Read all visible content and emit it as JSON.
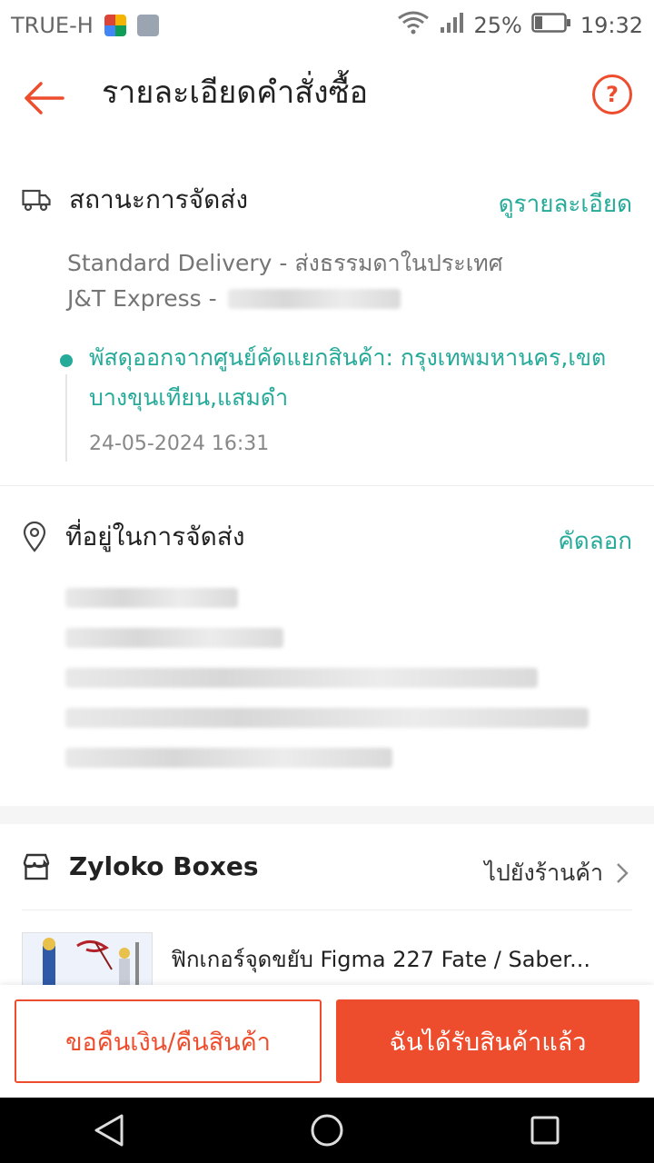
{
  "status_bar": {
    "carrier": "TRUE-H",
    "battery": "25%",
    "time": "19:32",
    "icons": [
      "app-icon",
      "gallery-icon",
      "wifi-icon",
      "signal-icon",
      "battery-icon"
    ]
  },
  "header": {
    "title": "รายละเอียดคำสั่งซื้อ",
    "help_label": "?"
  },
  "delivery": {
    "title": "สถานะการจัดส่ง",
    "link": "ดูรายละเอียด",
    "method": "Standard Delivery - ส่งธรรมดาในประเทศ",
    "courier": "J&T Express -",
    "status_text": "พัสดุออกจากศูนย์คัดแยกสินค้า: กรุงเทพมหานคร,เขตบางขุนเทียน,แสมดำ",
    "status_time": "24-05-2024 16:31"
  },
  "address": {
    "title": "ที่อยู่ในการจัดส่ง",
    "link": "คัดลอก"
  },
  "shop": {
    "name": "Zyloko Boxes",
    "link": "ไปยังร้านค้า",
    "product_title": "ฟิกเกอร์จุดขยับ Figma 227 Fate / Saber..."
  },
  "actions": {
    "refund_label": "ขอคืนเงิน/คืนสินค้า",
    "received_label": "ฉันได้รับสินค้าแล้ว"
  },
  "colors": {
    "brand": "#ee4d2d",
    "teal": "#26aa99"
  }
}
